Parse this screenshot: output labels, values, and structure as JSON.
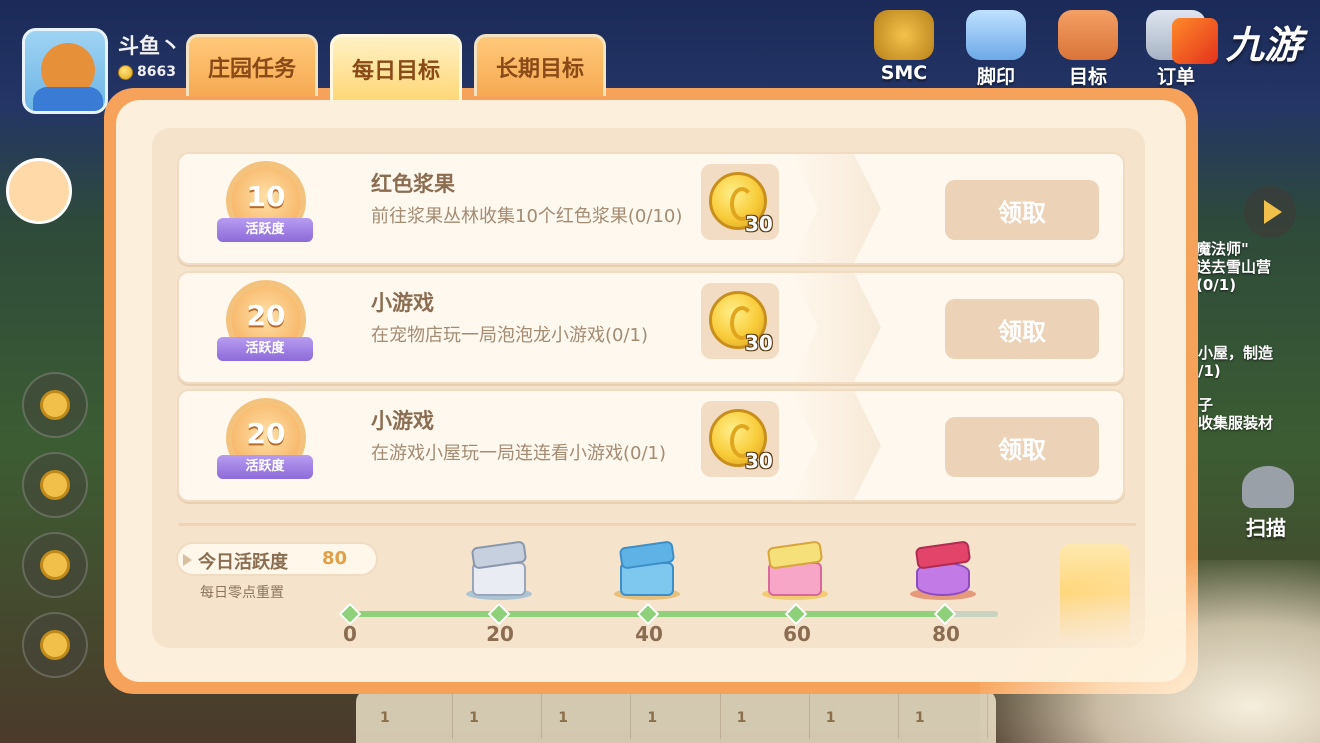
{
  "player": {
    "name": "斗鱼丶",
    "coins": "8663"
  },
  "top_icons": [
    {
      "label": "SMC",
      "icon": "smc-badge-icon"
    },
    {
      "label": "脚印",
      "icon": "footprint-icon"
    },
    {
      "label": "目标",
      "icon": "target-card-icon"
    },
    {
      "label": "订单",
      "icon": "order-clipboard-icon"
    }
  ],
  "watermark": {
    "text": "九游"
  },
  "tabs": [
    {
      "label": "庄园任务",
      "active": false
    },
    {
      "label": "每日目标",
      "active": true
    },
    {
      "label": "长期目标",
      "active": false
    }
  ],
  "tasks": [
    {
      "badge_value": "10",
      "badge_label": "活跃度",
      "title": "红色浆果",
      "description": "前往浆果丛林收集10个红色浆果(0/10)",
      "reward_amount": "30",
      "button": "领取"
    },
    {
      "badge_value": "20",
      "badge_label": "活跃度",
      "title": "小游戏",
      "description": "在宠物店玩一局泡泡龙小游戏(0/1)",
      "reward_amount": "30",
      "button": "领取"
    },
    {
      "badge_value": "20",
      "badge_label": "活跃度",
      "title": "小游戏",
      "description": "在游戏小屋玩一局连连看小游戏(0/1)",
      "reward_amount": "30",
      "button": "领取"
    }
  ],
  "activity": {
    "label": "今日活跃度",
    "value": "80",
    "reset_note": "每日零点重置",
    "progress_fraction": 0.92,
    "milestones": [
      "0",
      "20",
      "40",
      "60",
      "80"
    ]
  },
  "right_quests": [
    {
      "line1": "魔法师\"",
      "line2": "送去雪山营",
      "line3": "(0/1)"
    },
    {
      "line1": "小屋，制造",
      "line2": "/1)"
    },
    {
      "line1": "子",
      "line2": "收集服装材"
    }
  ],
  "scan_label": "扫描",
  "bottom_slots": [
    "1",
    "1",
    "1",
    "1",
    "1",
    "1",
    "1"
  ],
  "colors": {
    "panel_orange": "#f7a25a",
    "panel_cream": "#fcefdc",
    "progress_green": "#8fd07b",
    "badge_purple": "#8d6bd9",
    "coin_gold": "#f8cc3a"
  }
}
